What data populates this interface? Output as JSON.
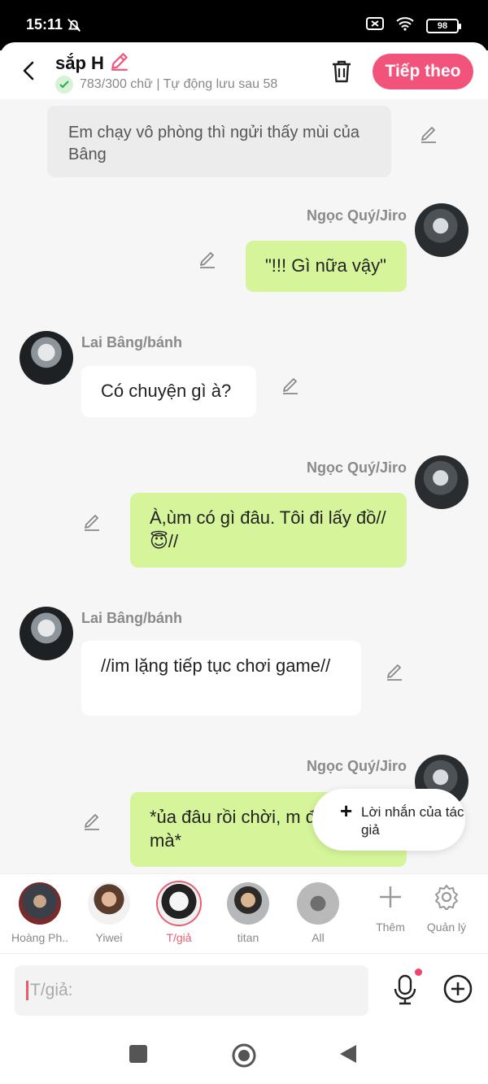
{
  "status": {
    "time": "15:11",
    "battery": "98"
  },
  "header": {
    "title": "sắp H",
    "save_status": "783/300 chữ | Tự động lưu sau 58",
    "next_label": "Tiếp theo"
  },
  "messages": {
    "narration": "Em chạy vô phòng thì ngửi thấy mùi của Bâng",
    "m1": {
      "name": "Ngọc Quý/Jiro",
      "text": "\"!!! Gì nữa vậy\""
    },
    "m2": {
      "name": "Lai Bâng/bánh",
      "text": "Có chuyện gì à?"
    },
    "m3": {
      "name": "Ngọc Quý/Jiro",
      "text": "À,ùm có gì đâu. Tôi đi lấy đồ//😇//"
    },
    "m4": {
      "name": "Lai Bâng/bánh",
      "text": "//im lặng tiếp tục chơi game//"
    },
    "m5": {
      "name": "Ngọc Quý/Jiro",
      "text": "*ủa đâu rồi chời, m để đây mà*"
    }
  },
  "float_note": {
    "label": "Lời nhắn của tác giả"
  },
  "characters": [
    {
      "label": "Hoàng Ph..."
    },
    {
      "label": "Yiwei"
    },
    {
      "label": "T/giả"
    },
    {
      "label": "titan"
    },
    {
      "label": "All"
    }
  ],
  "tools": {
    "add_label": "Thêm",
    "manage_label": "Quản lý"
  },
  "input": {
    "placeholder": "T/giả:"
  },
  "colors": {
    "accent": "#f2537a",
    "bubble_green": "#d6f59a",
    "active_char": "#e95a6e"
  }
}
